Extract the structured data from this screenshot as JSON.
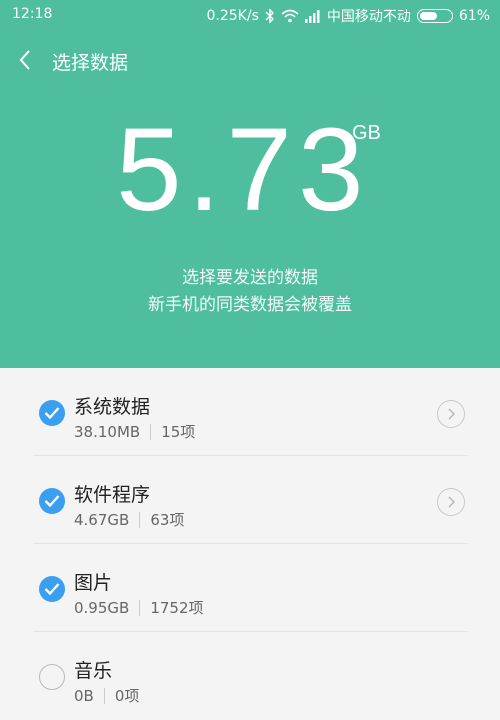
{
  "status": {
    "time": "12:18",
    "speed": "0.25K/s",
    "carrier": "中国移动不动",
    "battery": "61%",
    "battery_level": 0.61
  },
  "header": {
    "title": "选择数据"
  },
  "summary": {
    "total": "5.73",
    "unit": "GB",
    "line1": "选择要发送的数据",
    "line2": "新手机的同类数据会被覆盖"
  },
  "items": [
    {
      "name": "系统数据",
      "size": "38.10MB",
      "count": "15项",
      "checked": true,
      "has_detail": true
    },
    {
      "name": "软件程序",
      "size": "4.67GB",
      "count": "63项",
      "checked": true,
      "has_detail": true
    },
    {
      "name": "图片",
      "size": "0.95GB",
      "count": "1752项",
      "checked": true,
      "has_detail": false
    },
    {
      "name": "音乐",
      "size": "0B",
      "count": "0项",
      "checked": false,
      "has_detail": false
    }
  ],
  "colors": {
    "header_bg": "#4ebe9f",
    "check_on": "#3a9ff0",
    "list_bg": "#f4f4f4"
  },
  "icons": [
    "back-arrow-icon",
    "bluetooth-icon",
    "wifi-icon",
    "signal-icon",
    "battery-icon",
    "checkmark-icon",
    "chevron-right-icon"
  ]
}
